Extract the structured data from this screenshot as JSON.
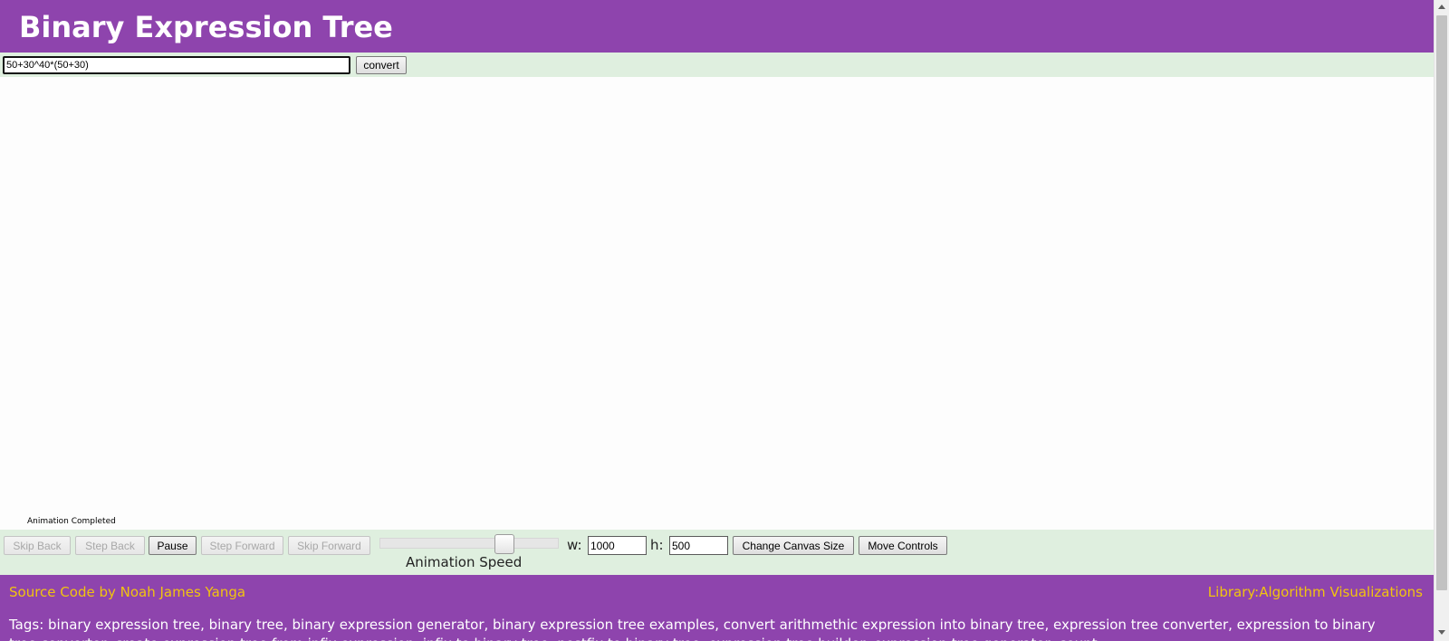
{
  "header": {
    "title": "Binary Expression Tree"
  },
  "algorithm_controls": {
    "expression_value": "50+30^40*(50+30)",
    "convert_label": "convert"
  },
  "canvas": {
    "status": "Animation Completed"
  },
  "animation_controls": {
    "skip_back_label": "Skip Back",
    "step_back_label": "Step Back",
    "pause_label": "Pause",
    "step_forward_label": "Step Forward",
    "skip_forward_label": "Skip Forward",
    "speed_label": "Animation Speed",
    "speed_value": 0.72,
    "width_label": "w:",
    "width_value": "1000",
    "height_label": "h:",
    "height_value": "500",
    "change_canvas_size_label": "Change Canvas Size",
    "move_controls_label": "Move Controls"
  },
  "footer": {
    "source_credit": "Source Code by Noah James Yanga",
    "library_link": "Library:Algorithm Visualizations",
    "tags": "Tags: binary expression tree, binary tree, binary expression generator, binary expression tree examples, convert arithmethic expression into binary tree, expression tree converter, expression to binary tree converter, create expression tree from infix expression, infix to binary tree, postfix to binary tree, expression tree builder, expression tree generator, count"
  },
  "colors": {
    "header_bg": "#8e44ad",
    "control_bar_bg": "#dfefdf",
    "footer_link": "#f1c40f",
    "title_text": "#ffffff"
  }
}
